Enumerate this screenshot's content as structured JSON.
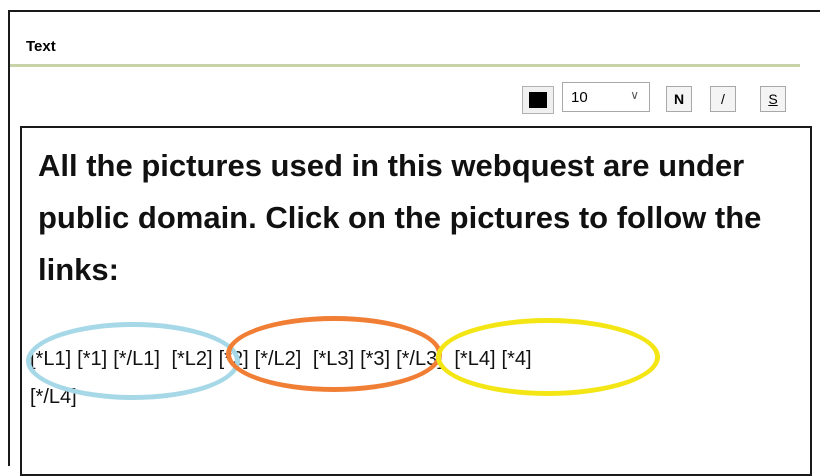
{
  "panel": {
    "title": "Text"
  },
  "toolbar": {
    "color_swatch": "#000000",
    "font_size": "10",
    "dropdown_arrow": "chevron-down-icon",
    "bold_label": "N",
    "italic_label": "/",
    "underline_label": "S"
  },
  "editor": {
    "headline": "All the pictures used in this webquest are under public domain. Click on the pictures to follow the links:",
    "tokens_line1": [
      "[*L1]",
      "[*1]",
      "[*/L1]",
      "[*L2]",
      "[*2]",
      "[*/L2]",
      "[*L3]",
      "[*3]",
      "[*/L3]",
      "[*L4]",
      "[*4]"
    ],
    "tokens_line2": [
      "[*/L4]"
    ]
  },
  "annotations": {
    "highlight_colors": [
      "#a6d8e8",
      "#f07f35",
      "#f4e514"
    ]
  }
}
